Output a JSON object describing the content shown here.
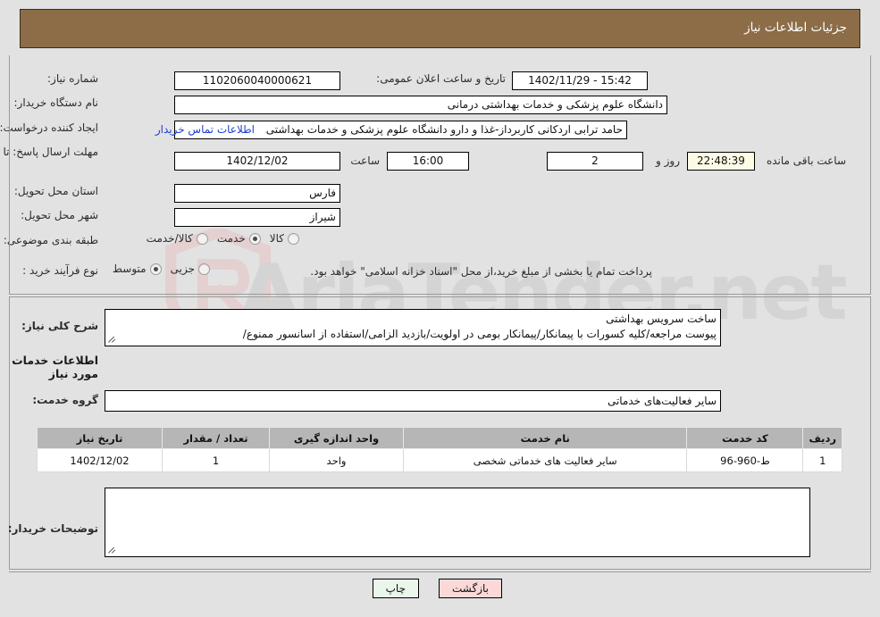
{
  "page": {
    "title": "جزئیات اطلاعات نیاز",
    "header_bg": "#8c6d47",
    "link_color": "#1d3fcf",
    "watermark_text": "AriaTender.net"
  },
  "fields": {
    "need_number_label": "شماره نیاز:",
    "need_number_value": "1102060040000621",
    "announce_datetime_label": "تاریخ و ساعت اعلان عمومی:",
    "announce_datetime_value": "15:42 - 1402/11/29",
    "buyer_org_label": "نام دستگاه خریدار:",
    "buyer_org_value": "دانشگاه علوم پزشکی و خدمات بهداشتی درمانی",
    "requester_label": "ایجاد کننده درخواست:",
    "requester_value": "حامد ترابی اردکانی کاربرداز-غذا و دارو دانشگاه علوم پزشکی و خدمات بهداشتی",
    "buyer_contact_link": "اطلاعات تماس خریدار",
    "deadline_label": "مهلت ارسال پاسخ: تا تاریخ:",
    "deadline_date_value": "1402/12/02",
    "deadline_hour_label": "ساعت",
    "deadline_hour_value": "16:00",
    "remaining_days_value": "2",
    "remaining_days_label": "روز و",
    "remaining_time_value": "22:48:39",
    "remaining_time_label": "ساعت باقی مانده",
    "province_label": "استان محل تحویل:",
    "province_value": "فارس",
    "city_label": "شهر محل تحویل:",
    "city_value": "شیراز",
    "category_label": "طبقه بندی موضوعی:",
    "purchase_type_label": "نوع فرآیند خرید :",
    "treasury_note": "پرداخت تمام یا بخشی از مبلغ خرید،از محل \"اسناد خزانه اسلامی\" خواهد بود."
  },
  "category_options": [
    {
      "label": "کالا",
      "selected": false
    },
    {
      "label": "خدمت",
      "selected": true
    },
    {
      "label": "کالا/خدمت",
      "selected": false
    }
  ],
  "purchase_options": [
    {
      "label": "جزیی",
      "selected": false
    },
    {
      "label": "متوسط",
      "selected": true
    }
  ],
  "description": {
    "label": "شرح کلی نیاز:",
    "line1": "ساخت سرویس بهداشتی",
    "line2": "پیوست مراجعه/کلیه کسورات با پیمانکار/پیمانکار بومی در اولویت/بازدید الزامی/استفاده از اسانسور ممنوع/"
  },
  "services_section": {
    "heading": "اطلاعات خدمات مورد نیاز",
    "group_label": "گروه خدمت:",
    "group_value": "سایر فعالیت‌های خدماتی"
  },
  "table": {
    "headers": [
      "ردیف",
      "کد خدمت",
      "نام خدمت",
      "واحد اندازه گیری",
      "تعداد / مقدار",
      "تاریخ نیاز"
    ],
    "rows": [
      {
        "index": "1",
        "code": "ط-960-96",
        "name": "سایر فعالیت های خدماتی شخصی",
        "unit": "واحد",
        "qty": "1",
        "date": "1402/12/02"
      }
    ]
  },
  "buyer_notes": {
    "label": "توضیحات خریدار:",
    "value": ""
  },
  "buttons": {
    "print": "چاپ",
    "back": "بازگشت"
  }
}
